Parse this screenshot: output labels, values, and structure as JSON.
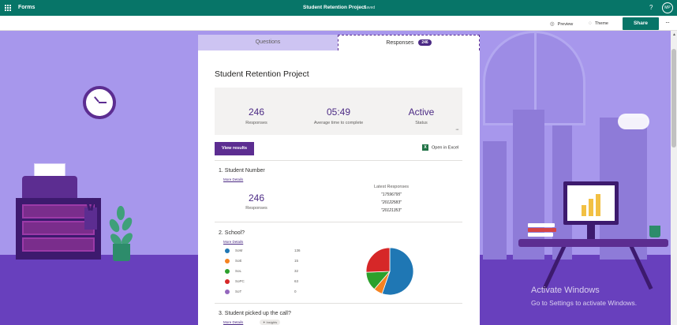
{
  "topbar": {
    "app_name": "Forms",
    "doc_title": "Student Retention Project",
    "doc_status": "Saved",
    "help": "?",
    "avatar": "MP"
  },
  "commands": {
    "preview": "Preview",
    "theme": "Theme",
    "share": "Share",
    "more": "···"
  },
  "tabs": {
    "questions": "Questions",
    "responses": "Responses",
    "responses_count": "246"
  },
  "form": {
    "title": "Student Retention Project",
    "summary": {
      "responses_value": "246",
      "responses_label": "Responses",
      "avg_time_value": "05:49",
      "avg_time_label": "Average time to complete",
      "status_value": "Active",
      "status_label": "Status",
      "more": "···"
    },
    "view_results": "View results",
    "open_excel": "Open in Excel"
  },
  "questions": [
    {
      "title": "1.  Student Number",
      "more_details": "More Details",
      "count_value": "246",
      "count_label": "Responses",
      "latest_header": "Latest Responses",
      "latest": [
        "\"17596795\"",
        "\"20122583\"",
        "\"20121353\""
      ]
    },
    {
      "title": "2.  School?",
      "more_details": "More Details"
    },
    {
      "title": "3.  Student picked up the call?",
      "more_details": "More Details",
      "insights": "Insights"
    }
  ],
  "chart_data": {
    "type": "pie",
    "categories": [
      "SoM",
      "SoE",
      "SoL",
      "SoPC",
      "SoT"
    ],
    "values": [
      136,
      15,
      32,
      63,
      0
    ],
    "colors": [
      "#1f77b4",
      "#f58220",
      "#2ca02c",
      "#d62728",
      "#9467bd"
    ]
  },
  "watermark": {
    "title": "Activate Windows",
    "subtitle": "Go to Settings to activate Windows."
  },
  "icons": {
    "waffle": "waffle-icon",
    "preview": "eye-icon",
    "theme": "palette-icon",
    "excel": "excel-icon"
  }
}
